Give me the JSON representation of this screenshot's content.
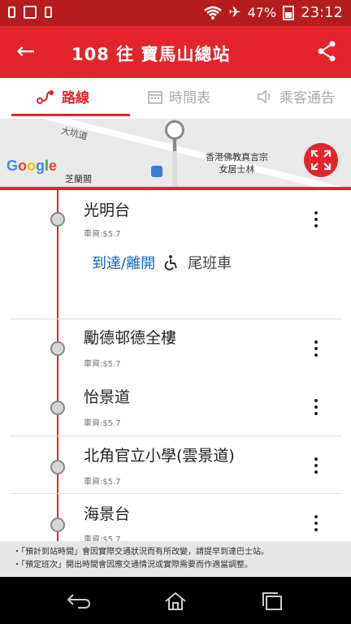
{
  "status_bar": {
    "battery": "47%",
    "time": "23:12"
  },
  "app_bar": {
    "back_icon": "arrow-left-icon",
    "title": "108 往 寶馬山總站",
    "share_icon": "share-icon"
  },
  "tabs": [
    {
      "label": "路線",
      "icon": "route-icon",
      "active": true
    },
    {
      "label": "時間表",
      "icon": "calendar-icon",
      "active": false
    },
    {
      "label": "乘客通告",
      "icon": "speaker-icon",
      "active": false
    }
  ],
  "map": {
    "street": "大坑道",
    "place_1": "香港佛教真言宗",
    "place_2": "女居士林",
    "place_3": "芝蘭閣",
    "logo": "Google"
  },
  "stops": [
    {
      "name": "光明台",
      "fare": "車資:$5.7"
    },
    {
      "name": "勵德邨德全樓",
      "fare": "車資:$5.7"
    },
    {
      "name": "怡景道",
      "fare": "車資:$5.7"
    },
    {
      "name": "北角官立小學(雲景道)",
      "fare": "車資:$5.7"
    },
    {
      "name": "海景台",
      "fare": "車資:$5.7"
    }
  ],
  "stop_actions": {
    "arrival": "到達/離開",
    "accessible_icon": "wheelchair-icon",
    "last_bus": "尾班車"
  },
  "notices": [
    "・「預計到站時間」會因實際交通狀況而有所改變，請提早到達巴士站。",
    "・「預定班次」開出時間會因應交通情況或實際需要而作適當調整。"
  ],
  "colors": {
    "brand": "#e3242b",
    "status_bar": "#b71c1c",
    "link": "#1565c0"
  }
}
